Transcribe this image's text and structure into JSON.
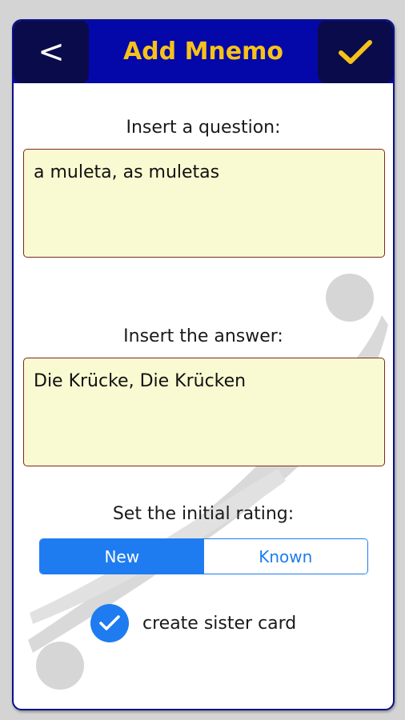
{
  "header": {
    "back_label": "<",
    "title": "Add Mnemo",
    "confirm_icon": "checkmark-icon"
  },
  "question": {
    "label": "Insert a question:",
    "value": "a muleta, as muletas"
  },
  "answer": {
    "label": "Insert the answer:",
    "value": "Die Krücke, Die Krücken"
  },
  "rating": {
    "label": "Set the initial rating:",
    "options": [
      "New",
      "Known"
    ],
    "selected": "New"
  },
  "sister_card": {
    "label": "create sister card",
    "checked": true
  },
  "colors": {
    "header_bg": "#0508a8",
    "header_button_bg": "#0a0b4a",
    "title": "#f6c21a",
    "field_bg": "#fafad2",
    "accent": "#1e7cf0"
  }
}
